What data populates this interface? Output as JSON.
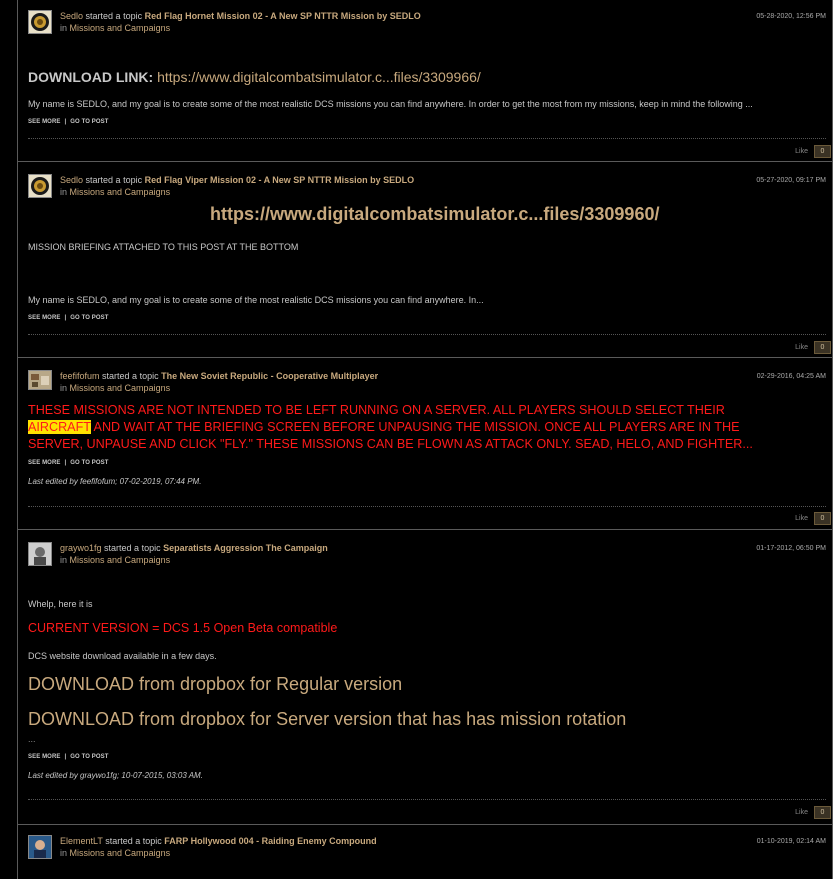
{
  "posts": [
    {
      "user": "Sedlo",
      "action": "started a topic",
      "topic": "Red Flag Hornet Mission 02 - A New SP NTTR Mission by SEDLO",
      "in": "in",
      "forum": "Missions and Campaigns",
      "date": "05-28-2020, 12:56 PM",
      "download_label": "DOWNLOAD LINK:",
      "download_url": "https://www.digitalcombatsimulator.c...files/3309966/",
      "excerpt": "My name is SEDLO, and my goal is to create some of the most realistic DCS missions you can find anywhere. In order to get the most from my missions, keep in mind the following ...",
      "see_more": "SEE MORE",
      "sep": "|",
      "go_to_post": "GO TO POST",
      "like_label": "Like",
      "like_count": "0"
    },
    {
      "user": "Sedlo",
      "action": "started a topic",
      "topic": "Red Flag Viper Mission 02 - A New SP NTTR Mission by SEDLO",
      "in": "in",
      "forum": "Missions and Campaigns",
      "date": "05-27-2020, 09:17 PM",
      "big_url": "https://www.digitalcombatsimulator.c...files/3309960/",
      "briefing": "MISSION BRIEFING ATTACHED TO THIS POST AT THE BOTTOM",
      "excerpt": "My name is SEDLO, and my goal is to create some of the most realistic DCS missions you can find anywhere. In...",
      "see_more": "SEE MORE",
      "sep": "|",
      "go_to_post": "GO TO POST",
      "like_label": "Like",
      "like_count": "0"
    },
    {
      "user": "feefifofum",
      "action": "started a topic",
      "topic": "The New Soviet Republic - Cooperative Multiplayer",
      "in": "in",
      "forum": "Missions and Campaigns",
      "date": "02-29-2016, 04:25 AM",
      "red_line1": "THESE MISSIONS ARE NOT INTENDED TO BE LEFT RUNNING ON A SERVER. ALL PLAYERS SHOULD SELECT THEIR",
      "red_highlight": "AIRCRAFT",
      "red_line2_rest": " AND WAIT AT THE BRIEFING SCREEN BEFORE UNPAUSING THE MISSION. ONCE ALL PLAYERS ARE IN THE",
      "red_line3": "SERVER, UNPAUSE AND CLICK \"FLY.\" THESE MISSIONS CAN BE FLOWN AS ATTACK ONLY. SEAD, HELO, AND FIGHTER...",
      "see_more": "SEE MORE",
      "sep": "|",
      "go_to_post": "GO TO POST",
      "last_edited": "Last edited by feefifofum; 07-02-2019, 07:44 PM.",
      "like_label": "Like",
      "like_count": "0"
    },
    {
      "user": "graywo1fg",
      "action": "started a topic",
      "topic": "Separatists Aggression The Campaign",
      "in": "in",
      "forum": "Missions and Campaigns",
      "date": "01-17-2012, 06:50 PM",
      "line1": "Whelp, here it is",
      "version": "CURRENT VERSION = DCS 1.5 Open Beta compatible",
      "line2": "DCS website download available in a few days.",
      "dl1": "DOWNLOAD from dropbox for Regular version",
      "dl2": "DOWNLOAD from dropbox for Server version that has has mission rotation",
      "ellipsis": "...",
      "see_more": "SEE MORE",
      "sep": "|",
      "go_to_post": "GO TO POST",
      "last_edited": "Last edited by graywo1fg; 10-07-2015, 03:03 AM.",
      "like_label": "Like",
      "like_count": "0"
    },
    {
      "user": "ElementLT",
      "action": "started a topic",
      "topic": "FARP Hollywood 004 - Raiding Enemy Compound",
      "in": "in",
      "forum": "Missions and Campaigns",
      "date": "01-10-2019, 02:14 AM"
    }
  ]
}
